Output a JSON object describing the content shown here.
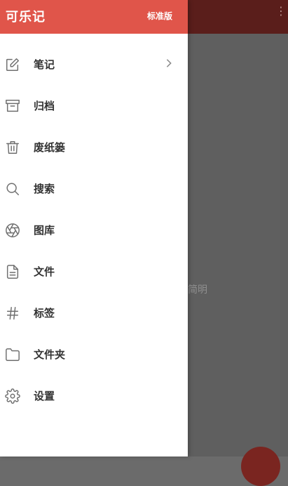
{
  "drawer": {
    "app_title": "可乐记",
    "edition": "标准版",
    "items": [
      {
        "label": "笔记",
        "icon": "edit-icon",
        "has_chevron": true
      },
      {
        "label": "归档",
        "icon": "archive-icon"
      },
      {
        "label": "废纸篓",
        "icon": "trash-icon"
      },
      {
        "label": "搜索",
        "icon": "search-icon"
      },
      {
        "label": "图库",
        "icon": "aperture-icon"
      },
      {
        "label": "文件",
        "icon": "file-icon"
      },
      {
        "label": "标签",
        "icon": "hashtag-icon"
      },
      {
        "label": "文件夹",
        "icon": "folder-icon"
      },
      {
        "label": "设置",
        "icon": "gear-icon"
      }
    ]
  },
  "background": {
    "hint_text": "简明"
  },
  "colors": {
    "header": "#e0554a",
    "scrim_header": "#5a1e1b",
    "scrim": "#5f5f5f",
    "fab": "#7a2520"
  }
}
